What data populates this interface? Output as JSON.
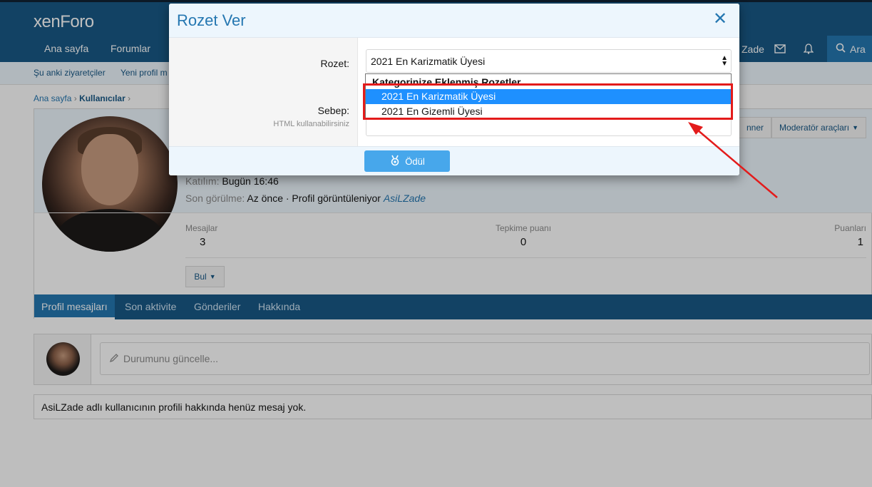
{
  "header": {
    "logo": "xenForo",
    "nav": [
      "Ana sayfa",
      "Forumlar"
    ],
    "user_fragment": "Zade",
    "search_label": "Ara"
  },
  "subnav": [
    "Şu anki ziyaretçiler",
    "Yeni profil m"
  ],
  "breadcrumb": [
    "Ana sayfa",
    "Kullanıcılar"
  ],
  "profile": {
    "mod_buttons": [
      "nner",
      "Moderatör araçları"
    ],
    "joined_label": "Katılım:",
    "joined_value": "Bugün 16:46",
    "last_seen_label": "Son görülme:",
    "last_seen_value": "Az önce · Profil görüntüleniyor",
    "last_seen_user": "AsiLZade",
    "stats": [
      {
        "label": "Mesajlar",
        "value": "3"
      },
      {
        "label": "Tepkime puanı",
        "value": "0"
      },
      {
        "label": "Puanları",
        "value": "1"
      }
    ],
    "find_label": "Bul",
    "tabs": [
      "Profil mesajları",
      "Son aktivite",
      "Gönderiler",
      "Hakkında"
    ]
  },
  "status_placeholder": "Durumunu güncelle...",
  "empty_message": "AsiLZade adlı kullanıcının profili hakkında henüz mesaj yok.",
  "modal": {
    "title": "Rozet Ver",
    "close": "✕",
    "rozet_label": "Rozet:",
    "selected_value": "2021 En Karizmatik Üyesi",
    "sebep_label": "Sebep:",
    "sebep_hint": "HTML kullanabilirsiniz",
    "dropdown_group": "Kategorinize Eklenmiş Rozetler",
    "options": [
      "2021 En Karizmatik Üyesi",
      "2021 En Gizemli Üyesi"
    ],
    "submit_label": "Ödül"
  },
  "colors": {
    "header": "#185886",
    "accent": "#2577b1",
    "highlight": "#e31b1b",
    "selected_option": "#1e90ff"
  }
}
